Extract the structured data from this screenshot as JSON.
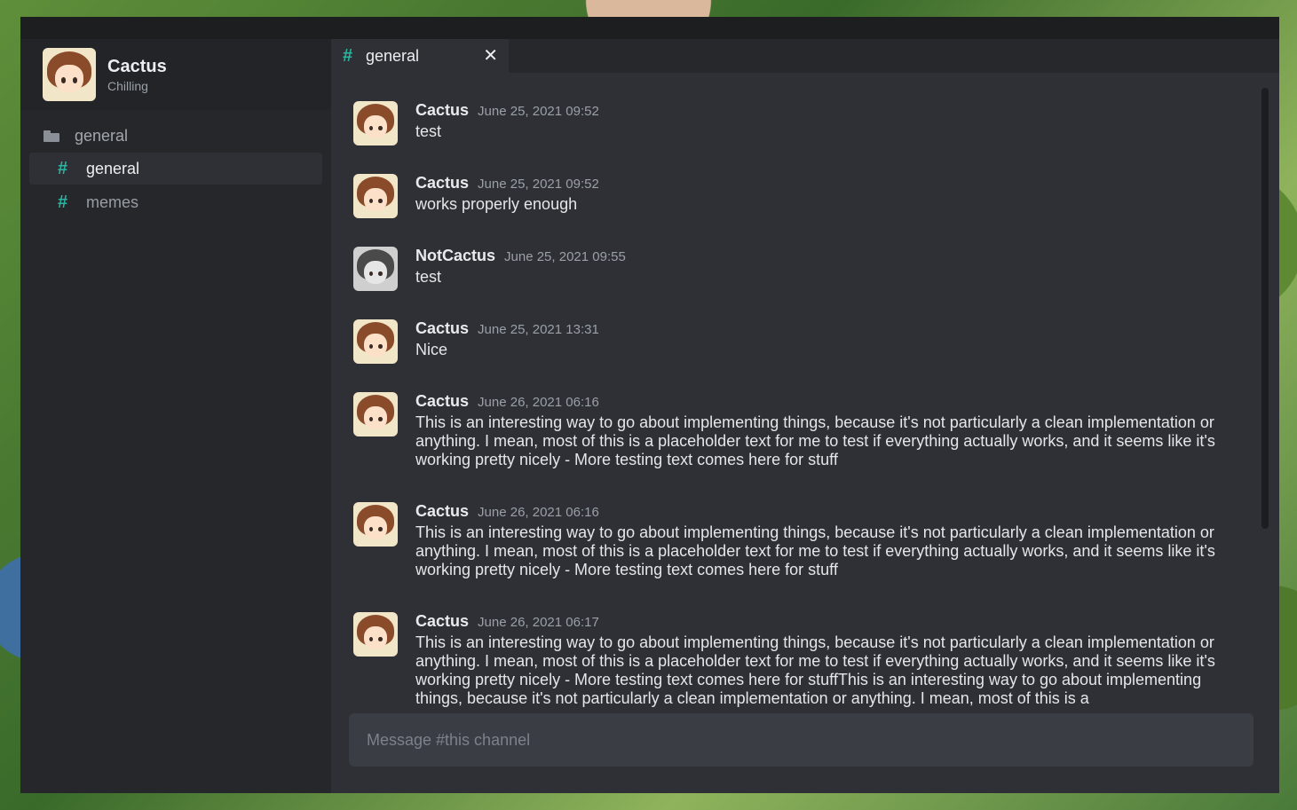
{
  "profile": {
    "name": "Cactus",
    "status": "Chilling"
  },
  "sidebar": {
    "folder": {
      "label": "general",
      "icon": "folder-open-icon"
    },
    "channels": [
      {
        "label": "general",
        "active": true
      },
      {
        "label": "memes",
        "active": false
      }
    ]
  },
  "tab": {
    "label": "general",
    "close": "✕"
  },
  "messages": [
    {
      "author": "Cactus",
      "time": "June 25, 2021 09:52",
      "text": "test"
    },
    {
      "author": "Cactus",
      "time": "June 25, 2021 09:52",
      "text": "works properly enough"
    },
    {
      "author": "NotCactus",
      "time": "June 25, 2021 09:55",
      "text": "test"
    },
    {
      "author": "Cactus",
      "time": "June 25, 2021 13:31",
      "text": "Nice"
    },
    {
      "author": "Cactus",
      "time": "June 26, 2021 06:16",
      "text": "This is an interesting way to go about implementing things, because it's not particularly a clean implementation or anything. I mean, most of this is a placeholder text for me to test if everything actually works, and it seems like it's working pretty nicely - More testing text comes here for stuff"
    },
    {
      "author": "Cactus",
      "time": "June 26, 2021 06:16",
      "text": "This is an interesting way to go about implementing things, because it's not particularly a clean implementation or anything. I mean, most of this is a placeholder text for me to test if everything actually works, and it seems like it's working pretty nicely - More testing text comes here for stuff"
    },
    {
      "author": "Cactus",
      "time": "June 26, 2021 06:17",
      "text": "This is an interesting way to go about implementing things, because it's not particularly a clean implementation or anything. I mean, most of this is a placeholder text for me to test if everything actually works, and it seems like it's working pretty nicely - More testing text comes here for stuffThis is an interesting way to go about implementing things, because it's not particularly a clean implementation or anything. I mean, most of this is a"
    }
  ],
  "composer": {
    "placeholder": "Message #this channel"
  },
  "colors": {
    "accent": "#2ab5a0",
    "background": "#2e3035",
    "sidebar": "#25272b"
  }
}
